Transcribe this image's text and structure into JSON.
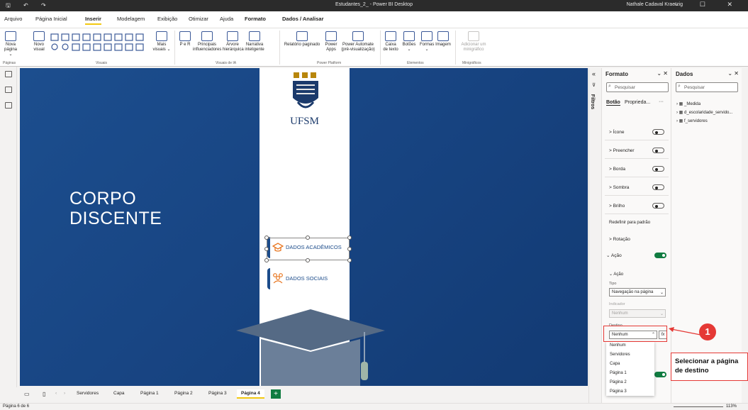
{
  "app": {
    "title": "Estudantes_2_ - Power BI Desktop",
    "user": "Nathale Cadaval Kraetzig",
    "quick_access": "🖫 ↶ ↷",
    "window_controls": "–   ☐   ✕"
  },
  "menu": [
    "Arquivo",
    "Página Inicial",
    "Inserir",
    "Modelagem",
    "Exibição",
    "Otimizar",
    "Ajuda",
    "Formato",
    "Dados / Analisar"
  ],
  "ribbon": {
    "b1": "Nova página ⌄",
    "b2": "Novo visual",
    "b3": "Mais visuais ⌄",
    "b4": "P e R",
    "b5": "Principais influenciadores",
    "b6": "Árvore hierárquica",
    "b7": "Narrativa inteligente",
    "b8": "Relatório paginado",
    "b9": "Power Apps",
    "b10": "Power Automate (pré-visualização)",
    "b11": "Caixa de texto",
    "b12": "Botões ⌄",
    "b13": "Formas ⌄",
    "b14": "Imagem",
    "b15": "Adicionar um minigráfico",
    "g1": "Páginas",
    "g2": "Visuais",
    "g3": "Visuais de IA",
    "g4": "Power Platform",
    "g5": "Elementos",
    "g6": "Minigráficos"
  },
  "canvas": {
    "title_line1": "CORPO",
    "title_line2": "DISCENTE",
    "logo_text": "UFSM",
    "btn1": "DADOS ACADÊMICOS",
    "btn2": "DADOS SOCIAIS",
    "more": "···"
  },
  "pages": {
    "tabs": [
      "Servidores",
      "Capa",
      "Página 1",
      "Página 2",
      "Página 3",
      "Página 4"
    ],
    "add": "+",
    "status": "Página 6 de 6",
    "zoom": "113%"
  },
  "filters": {
    "label": "Filtros"
  },
  "format": {
    "title": "Formato",
    "search_placeholder": "Pesquisar",
    "tab_visual": "Botão",
    "tab_props": "Proprieda...",
    "more": "···",
    "rows": [
      "> Ícone",
      "> Preencher",
      "> Borda",
      "> Sombra",
      "> Brilho"
    ],
    "reset": "Redefinir para padrão",
    "rotation": "> Rotação",
    "action": "⌄ Ação",
    "action_sub": "⌄ Ação",
    "type_label": "Tipo",
    "type_value": "Navegação na página",
    "indicator_label": "Indicador",
    "indicator_value": "Nenhum",
    "dest_label": "Destino",
    "dest_value": "Nenhum",
    "dest_options": [
      "Nenhum",
      "Servidores",
      "Capa",
      "Página 1",
      "Página 2",
      "Página 3"
    ]
  },
  "data": {
    "title": "Dados",
    "search_placeholder": "Pesquisar",
    "tables": [
      "_Medida",
      "d_escolaridade_servido...",
      "f_servidores"
    ]
  },
  "annotation": {
    "number": "1",
    "text": "Selecionar a página de destino"
  }
}
